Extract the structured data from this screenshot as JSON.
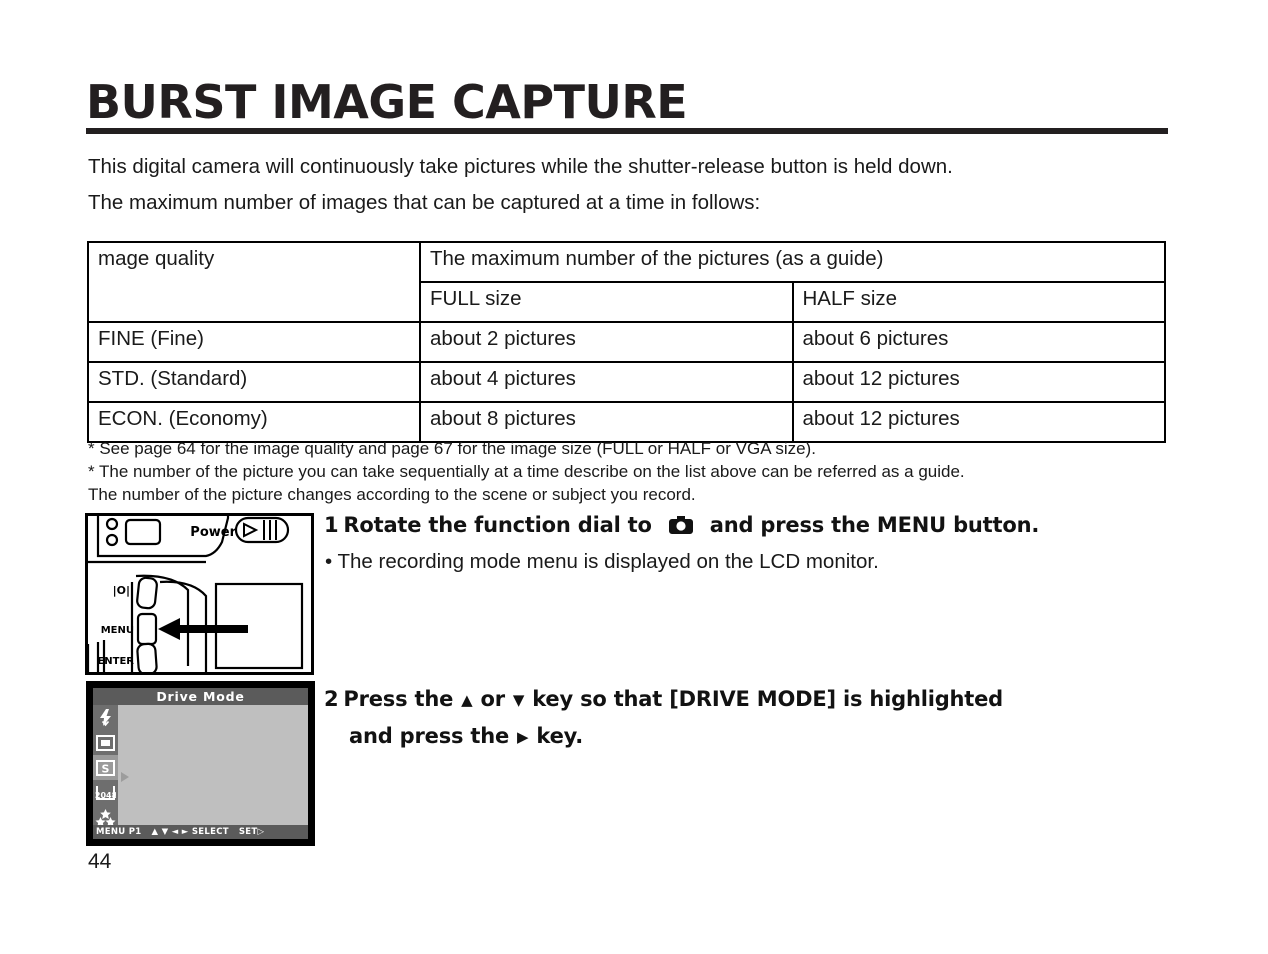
{
  "document": {
    "title": "BURST IMAGE CAPTURE",
    "page_number": "44"
  },
  "intro": {
    "line1": "This digital camera will continuously take pictures while the shutter-release button is held down.",
    "line2": "The maximum number of images that can be captured at a time in follows:"
  },
  "table": {
    "header_quality": "mage quality",
    "header_span": "The maximum number of the pictures (as a guide)",
    "header_full": "FULL size",
    "header_half": "HALF size",
    "rows": [
      {
        "quality": "FINE (Fine)",
        "full": "about 2 pictures",
        "half": "about 6 pictures"
      },
      {
        "quality": "STD. (Standard)",
        "full": "about 4 pictures",
        "half": "about 12 pictures"
      },
      {
        "quality": "ECON. (Economy)",
        "full": "about 8 pictures",
        "half": "about 12 pictures"
      }
    ]
  },
  "footnotes": {
    "line1": "* See page 64 for the image quality and page 67 for the image size (FULL or HALF or VGA size).",
    "line2": "* The number of the picture you can take sequentially at a time describe on the list above can be referred as a guide.",
    "line3": "The number of the picture changes according to the scene or subject you record."
  },
  "camera_figure": {
    "power_label": "Power",
    "display_button_label": "|O|",
    "menu_button_label": "MENU",
    "enter_button_label": "ENTER"
  },
  "step1": {
    "number": "1",
    "text_before_icon": "Rotate the function dial to",
    "icon": "camera-icon",
    "text_after_icon": "and press the MENU button.",
    "note": "• The recording mode menu is displayed on the LCD monitor."
  },
  "lcd_figure": {
    "title": "Drive Mode",
    "icons": [
      "flash-icon",
      "single-frame-icon",
      "drive-mode-s-icon",
      "resolution-2048-icon",
      "quality-stars-icon"
    ],
    "selected_icon": "drive-mode-s-icon",
    "resolution_label": "2048",
    "status_menu": "MENU P1",
    "status_keys": "▲ ▼ ◄ ►",
    "status_select": "SELECT",
    "status_set": "SET",
    "status_set_arrow": "▷"
  },
  "step2": {
    "number": "2",
    "line1_a": "Press the",
    "key_up": "▲",
    "line1_b": "or",
    "key_down": "▼",
    "line1_c": "key so that [DRIVE MODE] is highlighted",
    "line2_a": "and press the",
    "key_right": "▶",
    "line2_b": "key."
  },
  "colors": {
    "ink": "#231f20",
    "lcd_body": "#bfbfbf",
    "lcd_bar": "#5b5b5b",
    "lcd_icon_col": "#6e6e6e",
    "lcd_selected": "#9a9a9a"
  }
}
